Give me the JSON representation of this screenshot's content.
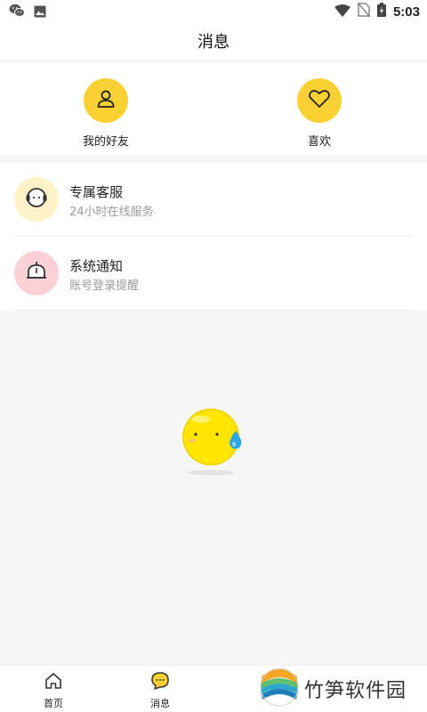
{
  "status_bar": {
    "time": "5:03"
  },
  "header": {
    "title": "消息"
  },
  "quick_actions": [
    {
      "label": "我的好友",
      "icon": "user-icon"
    },
    {
      "label": "喜欢",
      "icon": "heart-icon"
    }
  ],
  "messages": [
    {
      "title": "专属客服",
      "subtitle": "24小时在线服务",
      "icon": "headset-icon",
      "avatar_color": "#fff1c8"
    },
    {
      "title": "系统通知",
      "subtitle": "账号登录提醒",
      "icon": "bell-icon",
      "avatar_color": "#fbd0d6"
    }
  ],
  "tab_bar": {
    "items": [
      {
        "label": "首页",
        "icon": "home-icon"
      },
      {
        "label": "消息",
        "icon": "chat-icon"
      }
    ]
  },
  "watermark": {
    "text": "竹笋软件园"
  },
  "colors": {
    "accent": "#f9d132",
    "background": "#f7f7f7"
  }
}
